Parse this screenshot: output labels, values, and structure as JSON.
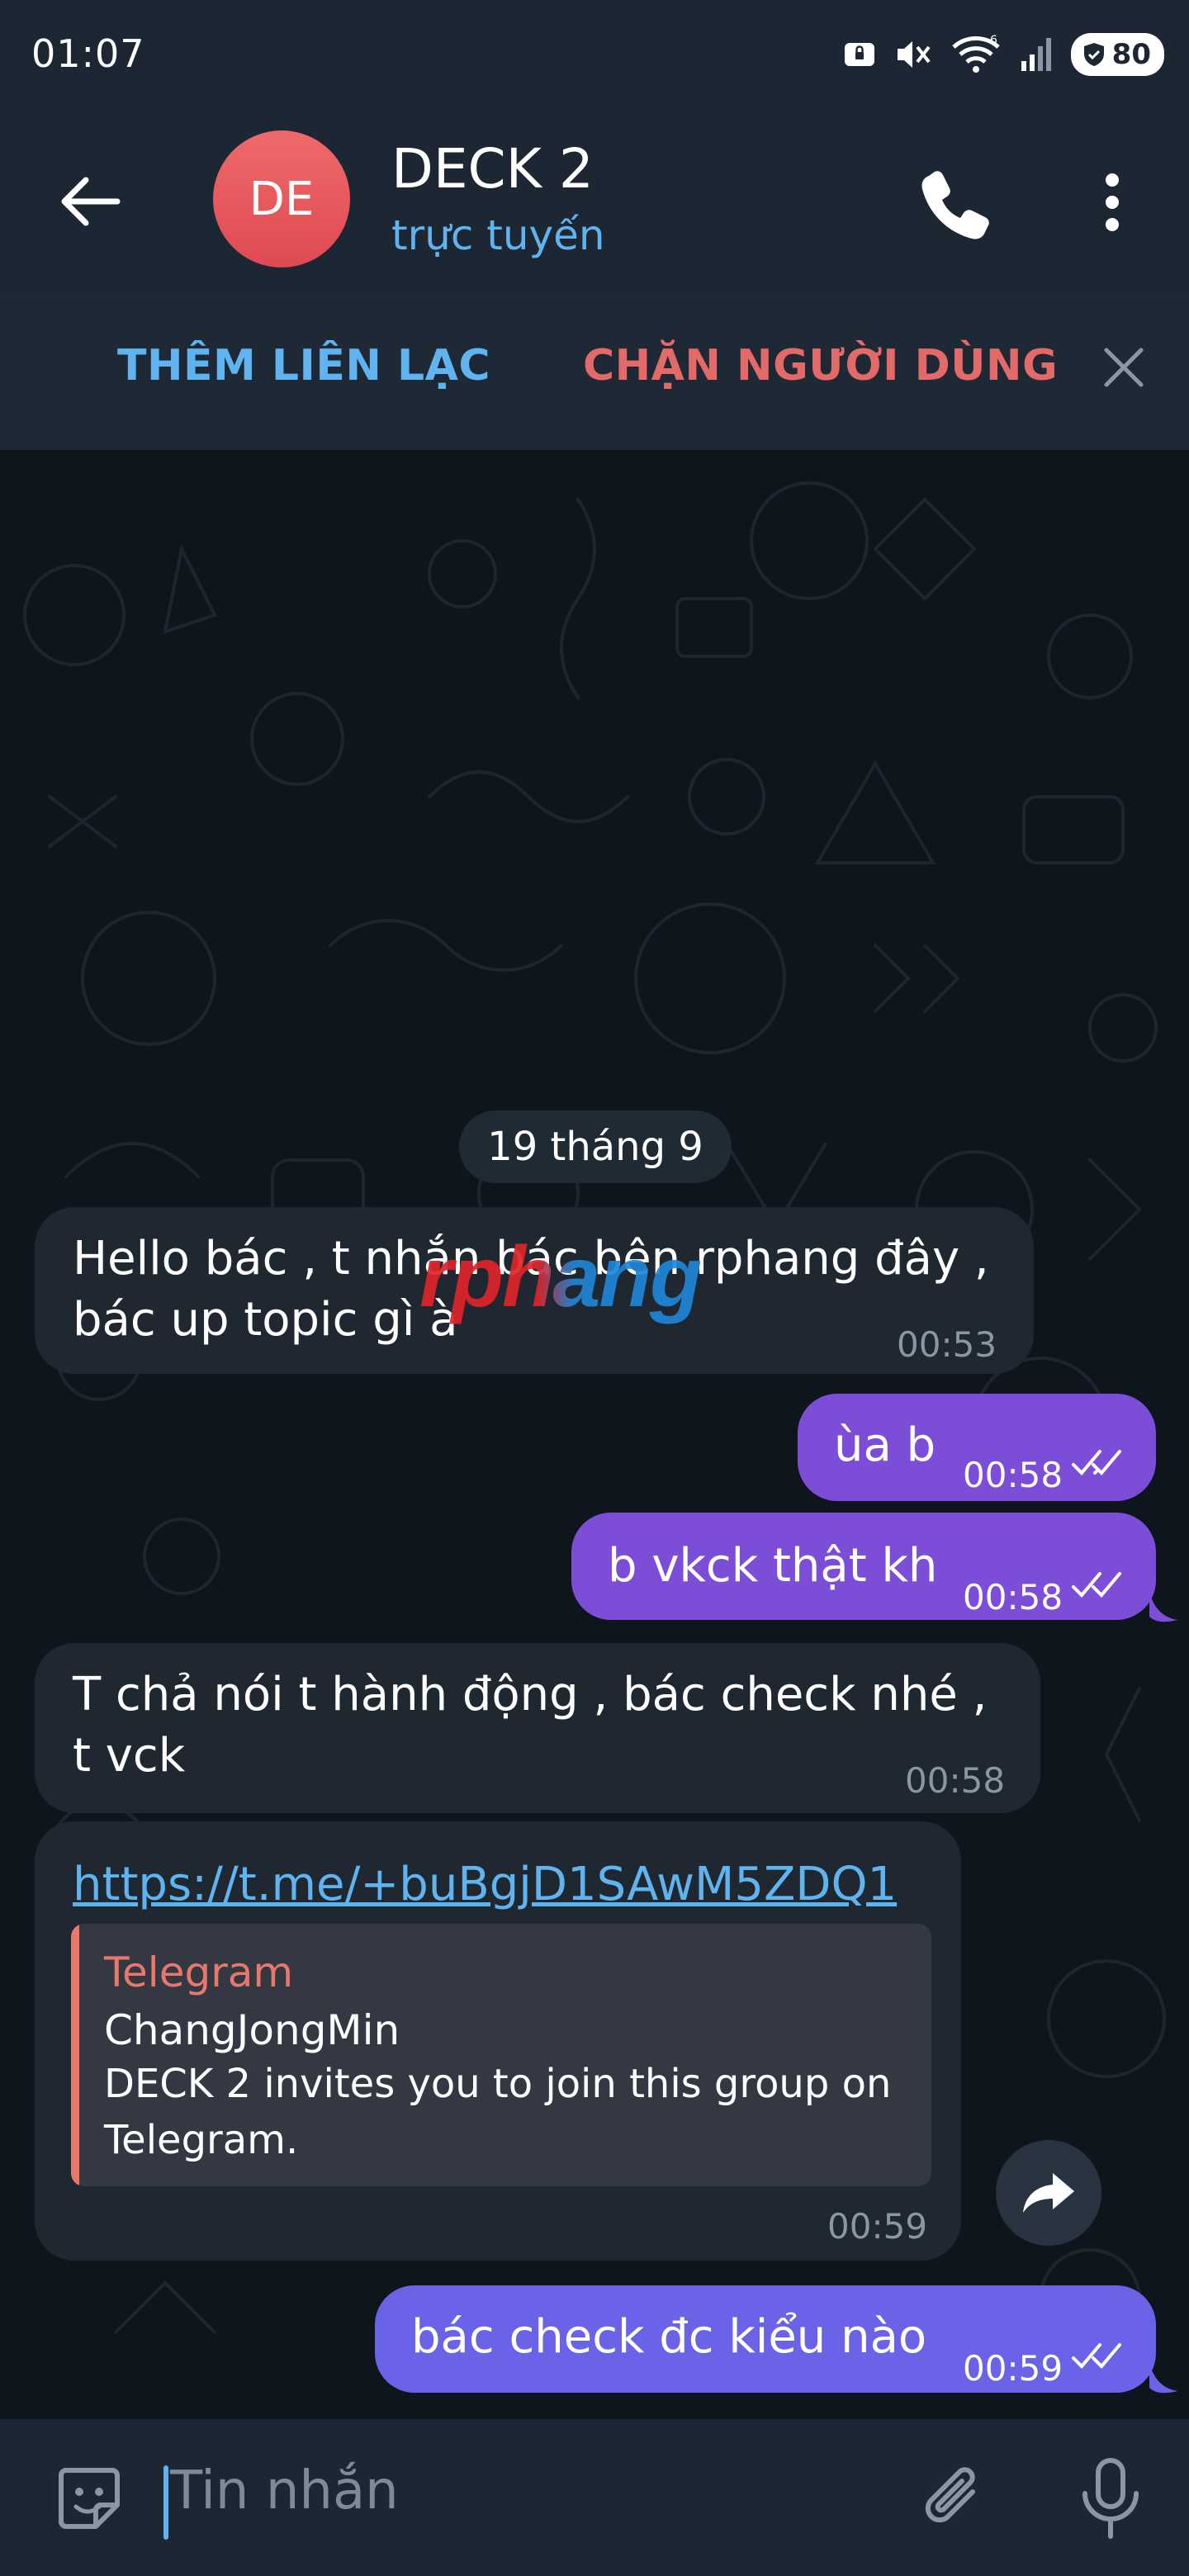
{
  "status_bar": {
    "time": "01:07",
    "network": "6",
    "battery": "80"
  },
  "header": {
    "avatar_initials": "DE",
    "avatar_color": "#e5555c",
    "title": "DECK 2",
    "status": "trực tuyến"
  },
  "action_bar": {
    "add_contact": "THÊM LIÊN LẠC",
    "block_user": "CHẶN NGƯỜI DÙNG"
  },
  "date_chip": "19 tháng 9",
  "messages": [
    {
      "direction": "in",
      "text": "Hello bác , t nhắn bác bên rphang đây ,\nbác up topic gì à",
      "time": "00:53"
    },
    {
      "direction": "out",
      "text": "ùa b",
      "time": "00:58",
      "read": true
    },
    {
      "direction": "out",
      "text": "b vkck thật kh",
      "time": "00:58",
      "read": true
    },
    {
      "direction": "in",
      "text": "T chả nói t hành động , bác check nhé ,\nt vck",
      "time": "00:58"
    },
    {
      "direction": "in",
      "link": "https://t.me/+buBgjD1SAwM5ZDQ1",
      "preview": {
        "site": "Telegram",
        "title": "ChangJongMin",
        "description": "DECK 2 invites you to join this group on Telegram."
      },
      "time": "00:59"
    },
    {
      "direction": "out",
      "text": "bác check đc kiểu nào",
      "time": "00:59",
      "read": true
    }
  ],
  "watermark": "rphang",
  "input": {
    "placeholder": "Tin nhắn"
  },
  "colors": {
    "accent": "#5fb3ee",
    "danger": "#e46a6a",
    "outgoing_bubble": "#7c4ed8",
    "incoming_bubble": "#1f2731"
  }
}
